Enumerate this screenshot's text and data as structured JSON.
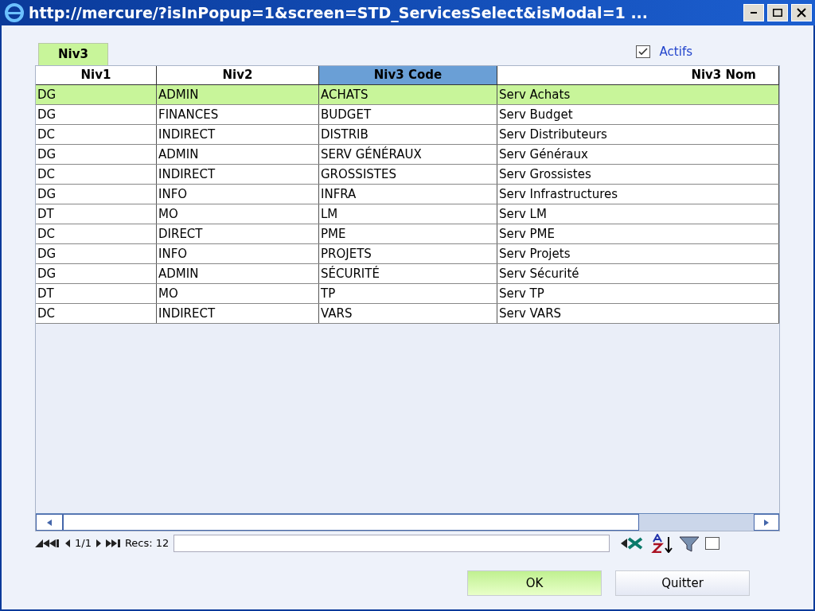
{
  "window": {
    "title": "http://mercure/?isInPopup=1&screen=STD_ServicesSelect&isModal=1 ..."
  },
  "tabs": [
    {
      "label": "Niv3",
      "selected": true
    }
  ],
  "filter": {
    "label": "Actifs",
    "checked": true
  },
  "table": {
    "columns": [
      {
        "label": "Niv1",
        "selected": false
      },
      {
        "label": "Niv2",
        "selected": false
      },
      {
        "label": "Niv3 Code",
        "selected": true
      },
      {
        "label": "Niv3 Nom",
        "selected": false
      }
    ],
    "rows": [
      {
        "cells": [
          "DG",
          "ADMIN",
          "ACHATS",
          "Serv Achats"
        ],
        "selected": true
      },
      {
        "cells": [
          "DG",
          "FINANCES",
          "BUDGET",
          "Serv Budget"
        ],
        "selected": false
      },
      {
        "cells": [
          "DC",
          "INDIRECT",
          "DISTRIB",
          "Serv Distributeurs"
        ],
        "selected": false
      },
      {
        "cells": [
          "DG",
          "ADMIN",
          "SERV GÉNÉRAUX",
          "Serv Généraux"
        ],
        "selected": false
      },
      {
        "cells": [
          "DC",
          "INDIRECT",
          "GROSSISTES",
          "Serv Grossistes"
        ],
        "selected": false
      },
      {
        "cells": [
          "DG",
          "INFO",
          "INFRA",
          "Serv Infrastructures"
        ],
        "selected": false
      },
      {
        "cells": [
          "DT",
          "MO",
          "LM",
          "Serv LM"
        ],
        "selected": false
      },
      {
        "cells": [
          "DC",
          "DIRECT",
          "PME",
          "Serv PME"
        ],
        "selected": false
      },
      {
        "cells": [
          "DG",
          "INFO",
          "PROJETS",
          "Serv Projets"
        ],
        "selected": false
      },
      {
        "cells": [
          "DG",
          "ADMIN",
          "SÉCURITÉ",
          "Serv Sécurité"
        ],
        "selected": false
      },
      {
        "cells": [
          "DT",
          "MO",
          "TP",
          "Serv TP"
        ],
        "selected": false
      },
      {
        "cells": [
          "DC",
          "INDIRECT",
          "VARS",
          "Serv VARS"
        ],
        "selected": false
      }
    ]
  },
  "pager": {
    "page": "1/1",
    "records": "Recs: 12",
    "option_checked": false
  },
  "buttons": [
    {
      "label": "OK",
      "kind": "primary"
    },
    {
      "label": "Quitter",
      "kind": "secondary"
    }
  ]
}
